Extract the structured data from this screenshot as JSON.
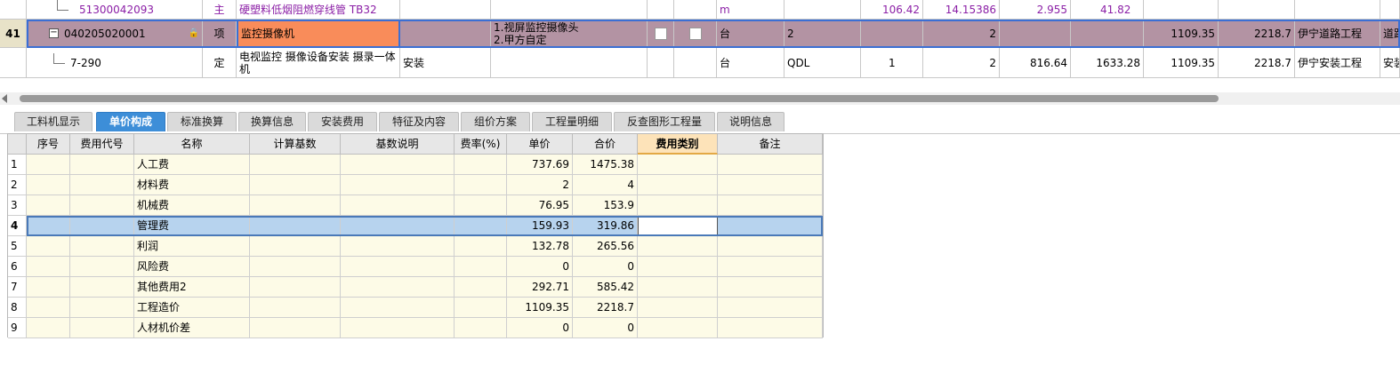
{
  "top_table": {
    "rows": [
      {
        "row_no": "",
        "code": "51300042093",
        "type": "主",
        "name": "硬塑料低烟阻燃穿线管 TB32",
        "spec": "",
        "feature": "",
        "unit": "m",
        "expr": "",
        "qty1": "106.42",
        "qty2": "14.15386",
        "price": "2.955",
        "total": "41.82",
        "unit_price": "",
        "sum_price": "",
        "profession": "",
        "extra": ""
      },
      {
        "row_no": "41",
        "code": "040205020001",
        "type": "项",
        "name": "监控摄像机",
        "spec": "",
        "feature": "1.视屏监控摄像头\n2.甲方自定",
        "unit": "台",
        "expr": "2",
        "qty1": "",
        "qty2": "2",
        "price": "",
        "total": "",
        "unit_price": "1109.35",
        "sum_price": "2218.7",
        "profession": "伊宁道路工程",
        "extra": "道路"
      },
      {
        "row_no": "",
        "code": "7-290",
        "type": "定",
        "name": "电视监控 摄像设备安装 摄录一体机",
        "spec": "安装",
        "feature": "",
        "unit": "台",
        "expr": "QDL",
        "qty1": "1",
        "qty2": "2",
        "price": "816.64",
        "total": "1633.28",
        "unit_price": "1109.35",
        "sum_price": "2218.7",
        "profession": "伊宁安装工程",
        "extra": "安装"
      }
    ]
  },
  "tabs": [
    {
      "label": "工料机显示",
      "active": false
    },
    {
      "label": "单价构成",
      "active": true
    },
    {
      "label": "标准换算",
      "active": false
    },
    {
      "label": "换算信息",
      "active": false
    },
    {
      "label": "安装费用",
      "active": false
    },
    {
      "label": "特征及内容",
      "active": false
    },
    {
      "label": "组价方案",
      "active": false
    },
    {
      "label": "工程量明细",
      "active": false
    },
    {
      "label": "反查图形工程量",
      "active": false
    },
    {
      "label": "说明信息",
      "active": false
    }
  ],
  "grid": {
    "headers": [
      "",
      "序号",
      "费用代号",
      "名称",
      "计算基数",
      "基数说明",
      "费率(%)",
      "单价",
      "合价",
      "费用类别",
      "备注"
    ],
    "rows": [
      {
        "n": "1",
        "name": "人工费",
        "price": "737.69",
        "total": "1475.38"
      },
      {
        "n": "2",
        "name": "材料费",
        "price": "2",
        "total": "4"
      },
      {
        "n": "3",
        "name": "机械费",
        "price": "76.95",
        "total": "153.9"
      },
      {
        "n": "4",
        "name": "管理费",
        "price": "159.93",
        "total": "319.86"
      },
      {
        "n": "5",
        "name": "利润",
        "price": "132.78",
        "total": "265.56"
      },
      {
        "n": "6",
        "name": "风险费",
        "price": "0",
        "total": "0"
      },
      {
        "n": "7",
        "name": "其他费用2",
        "price": "292.71",
        "total": "585.42"
      },
      {
        "n": "8",
        "name": "工程造价",
        "price": "1109.35",
        "total": "2218.7"
      },
      {
        "n": "9",
        "name": "人材机价差",
        "price": "0",
        "total": "0"
      }
    ],
    "selected_row": 4
  },
  "colors": {
    "accent_tab": "#3d8ed8",
    "selected_row": "#b393a3",
    "orange_cell": "#f98c5a",
    "purple_text": "#8b1fa6"
  }
}
